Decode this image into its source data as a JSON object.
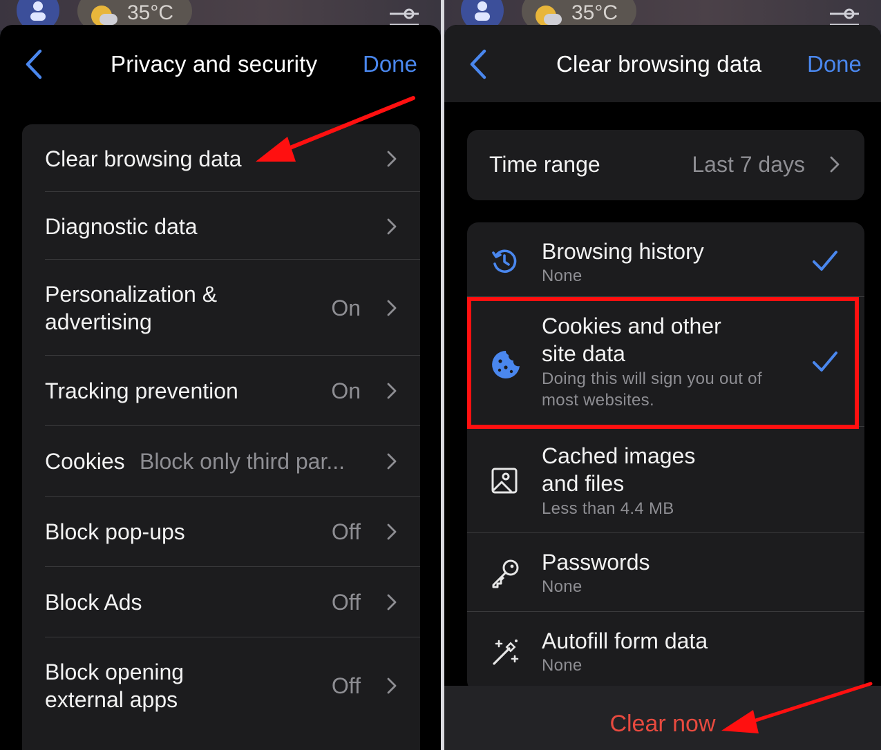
{
  "status": {
    "temperature": "35°C"
  },
  "left": {
    "title": "Privacy and security",
    "done": "Done",
    "rows": [
      {
        "label": "Clear browsing data",
        "value": ""
      },
      {
        "label": "Diagnostic data",
        "value": ""
      },
      {
        "label": "Personalization &",
        "label2": "advertising",
        "value": "On"
      },
      {
        "label": "Tracking prevention",
        "value": "On"
      },
      {
        "label": "Cookies",
        "value": "Block only third par..."
      },
      {
        "label": "Block pop-ups",
        "value": "Off"
      },
      {
        "label": "Block Ads",
        "value": "Off"
      },
      {
        "label": "Block opening",
        "label2": "external apps",
        "value": "Off"
      }
    ]
  },
  "right": {
    "title": "Clear browsing data",
    "done": "Done",
    "time_range": {
      "label": "Time range",
      "value": "Last 7 days"
    },
    "items": [
      {
        "icon": "history-icon",
        "title": "Browsing history",
        "sub": "None",
        "checked": true
      },
      {
        "icon": "cookie-icon",
        "title": "Cookies and other",
        "title2": "site data",
        "sub": "Doing this will sign you out of",
        "sub2": "most websites.",
        "checked": true
      },
      {
        "icon": "image-icon",
        "title": "Cached images",
        "title2": "and files",
        "sub": "Less than 4.4 MB",
        "checked": false
      },
      {
        "icon": "key-icon",
        "title": "Passwords",
        "sub": "None",
        "checked": false
      },
      {
        "icon": "magic-wand-icon",
        "title": "Autofill form data",
        "sub": "None",
        "checked": false
      }
    ],
    "clear_now": "Clear now"
  },
  "colors": {
    "accent": "#4a87ee",
    "destructive": "#e84a3f",
    "annotation": "#ff1010"
  }
}
